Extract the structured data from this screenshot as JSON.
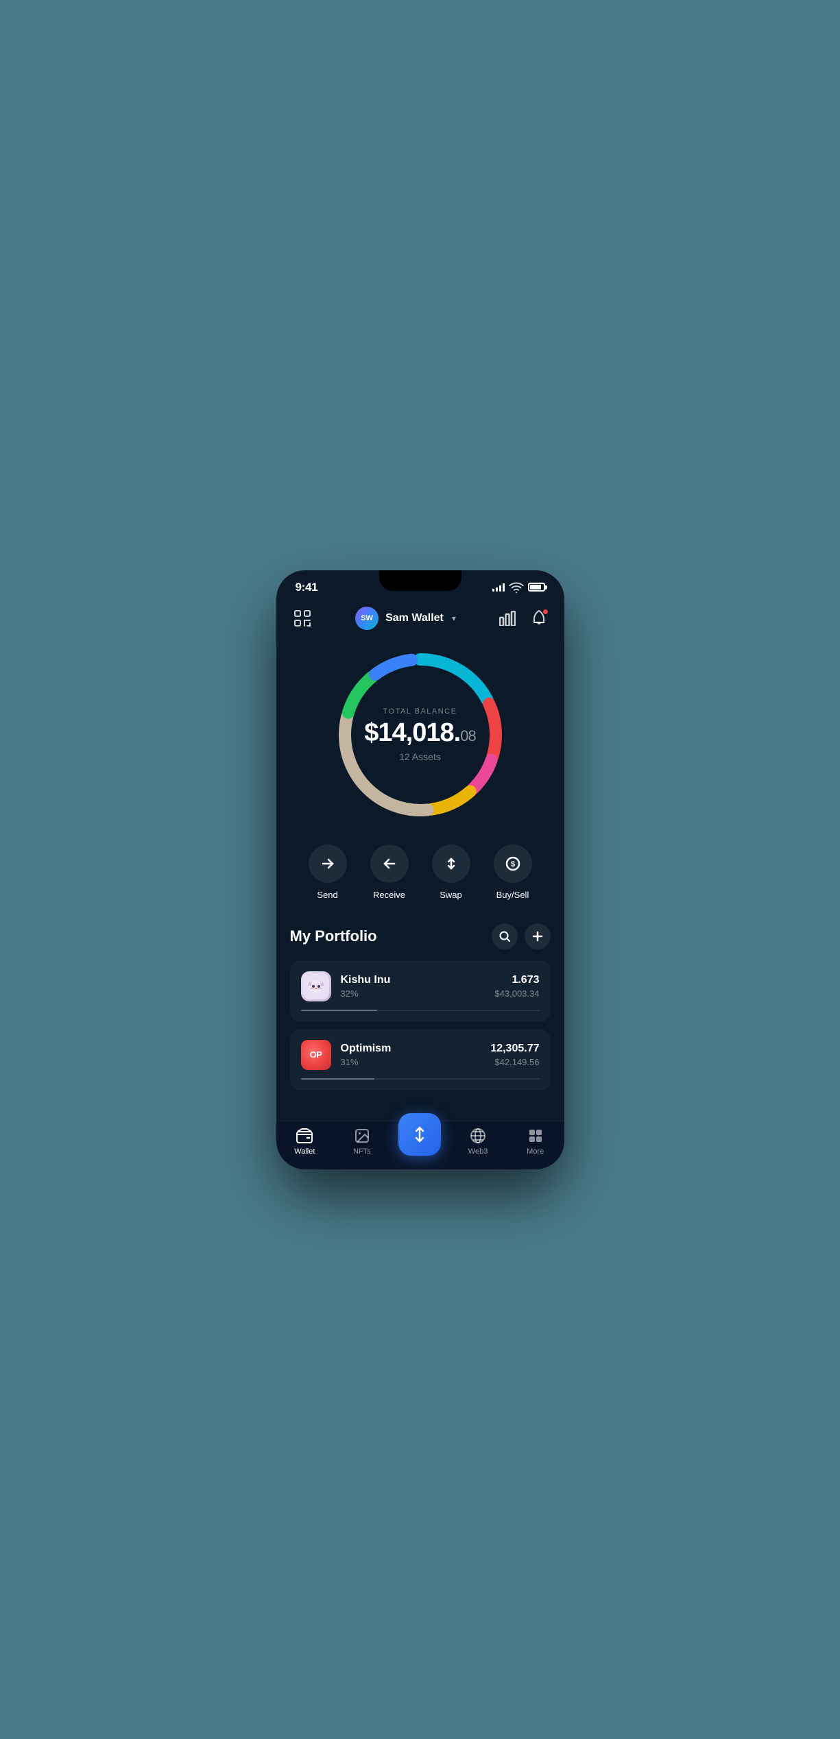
{
  "status_bar": {
    "time": "9:41",
    "signal_strength": 4,
    "battery_pct": 85
  },
  "header": {
    "scan_label": "scan",
    "avatar_initials": "SW",
    "wallet_name": "Sam Wallet",
    "dropdown_label": "dropdown",
    "chart_icon_label": "chart",
    "notification_icon_label": "notification"
  },
  "balance": {
    "label": "TOTAL BALANCE",
    "whole": "$14,018.",
    "cents": "08",
    "assets_label": "12 Assets"
  },
  "actions": [
    {
      "id": "send",
      "label": "Send",
      "icon": "→"
    },
    {
      "id": "receive",
      "label": "Receive",
      "icon": "←"
    },
    {
      "id": "swap",
      "label": "Swap",
      "icon": "⇅"
    },
    {
      "id": "buysell",
      "label": "Buy/Sell",
      "icon": "$"
    }
  ],
  "portfolio": {
    "title": "My Portfolio",
    "search_label": "search",
    "add_label": "add"
  },
  "assets": [
    {
      "id": "kishu",
      "name": "Kishu Inu",
      "percent": "32%",
      "amount": "1.673",
      "usd": "$43,003.34",
      "progress": 32,
      "icon_type": "kishu"
    },
    {
      "id": "optimism",
      "name": "Optimism",
      "percent": "31%",
      "amount": "12,305.77",
      "usd": "$42,149.56",
      "progress": 31,
      "icon_type": "op"
    }
  ],
  "bottom_nav": [
    {
      "id": "wallet",
      "label": "Wallet",
      "active": true
    },
    {
      "id": "nfts",
      "label": "NFTs",
      "active": false
    },
    {
      "id": "center",
      "label": "",
      "active": false,
      "is_center": true
    },
    {
      "id": "web3",
      "label": "Web3",
      "active": false
    },
    {
      "id": "more",
      "label": "More",
      "active": false
    }
  ],
  "donut_segments": [
    {
      "color": "#06b6d4",
      "percent": 18,
      "label": "cyan"
    },
    {
      "color": "#ef4444",
      "percent": 12,
      "label": "red"
    },
    {
      "color": "#ec4899",
      "percent": 8,
      "label": "pink"
    },
    {
      "color": "#eab308",
      "percent": 10,
      "label": "yellow"
    },
    {
      "color": "#c4b5a0",
      "percent": 32,
      "label": "beige"
    },
    {
      "color": "#22c55e",
      "percent": 10,
      "label": "green"
    },
    {
      "color": "#3b82f6",
      "percent": 10,
      "label": "blue"
    }
  ]
}
